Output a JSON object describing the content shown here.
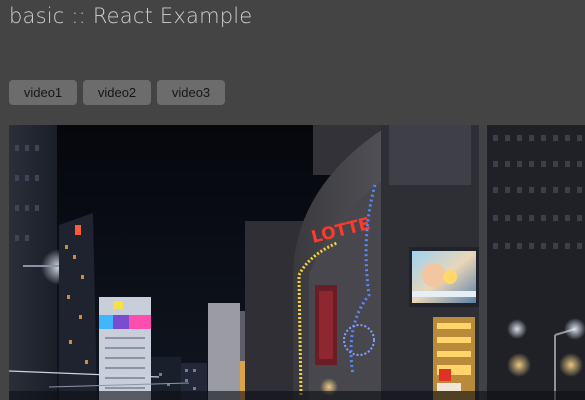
{
  "header": {
    "title": "basic :: React Example"
  },
  "toolbar": {
    "buttons": [
      {
        "label": "video1"
      },
      {
        "label": "video2"
      },
      {
        "label": "video3"
      }
    ]
  },
  "player": {
    "sign_text": "LOTTE"
  },
  "colors": {
    "page_background": "#444444",
    "button_background": "#6c6c6c",
    "title_text": "#cfcfcf",
    "sign_red": "#ff3a2a"
  }
}
